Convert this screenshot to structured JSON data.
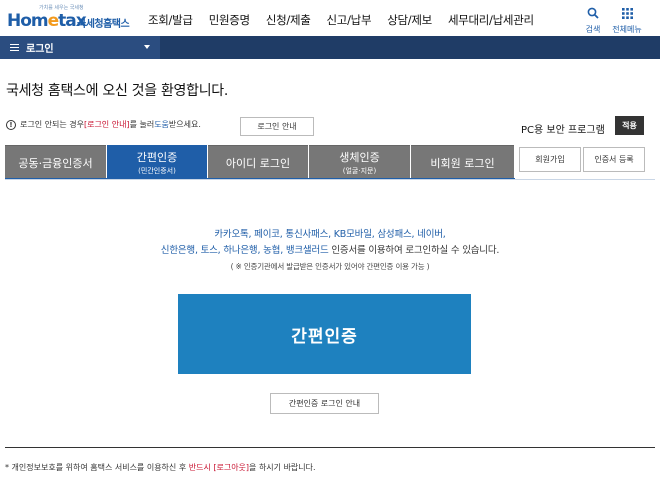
{
  "header": {
    "logo_slogan": "가치를 세우는 국세청",
    "logo_home": "Hom",
    "logo_e": "e",
    "logo_tax": "tax",
    "logo_nts": "국세청홈택스",
    "nav": [
      "조회/발급",
      "민원증명",
      "신청/제출",
      "신고/납부",
      "상담/제보",
      "세무대리/납세관리"
    ],
    "search_label": "검색",
    "menu_label": "전체메뉴"
  },
  "bar": {
    "title": "로그인"
  },
  "welcome": "국세청 홈택스에 오신 것을 환영합니다.",
  "notice": {
    "icon": "!",
    "pre": "로그인 안되는 경우 ",
    "link": "[로그인 안내]",
    "mid": "를 눌러 ",
    "help": "도움",
    "post": "받으세요.",
    "button": "로그인 안내"
  },
  "pc_security": {
    "label": "PC용 보안 프로그램",
    "button": "적용"
  },
  "tabs": [
    {
      "label": "공동·금융인증서",
      "sub": ""
    },
    {
      "label": "간편인증",
      "sub": "(민간인증서)"
    },
    {
      "label": "아이디 로그인",
      "sub": ""
    },
    {
      "label": "생체인증",
      "sub": "(얼굴·지문)"
    },
    {
      "label": "비회원 로그인",
      "sub": ""
    }
  ],
  "side_buttons": {
    "signup": "회원가입",
    "cert_register": "인증서 등록"
  },
  "providers": {
    "line1": "카카오톡, 페이코, 통신사패스, KB모바일, 삼성패스, 네이버,",
    "line2": "신한은행, 토스, 하나은행, 농협, 뱅크샐러드",
    "line2_tail": " 인증서를 이용하여 로그인하실 수 있습니다.",
    "note": "( ※ 인증기관에서 발급받은 인증서가 있어야 간편인증 이용 가능 )"
  },
  "main_button": "간편인증",
  "guide_button": "간편인증 로그인 안내",
  "footer": {
    "pre": "* 개인정보보호를 위하여 홈택스 서비스를 이용하신 후 ",
    "emph": "반드시 [로그아웃]",
    "post": "을 하시기 바랍니다."
  },
  "colors": {
    "primary": "#1f5ea8",
    "main_button": "#1e81bf",
    "bar": "#1f3c66",
    "tab_inactive": "#777777"
  }
}
